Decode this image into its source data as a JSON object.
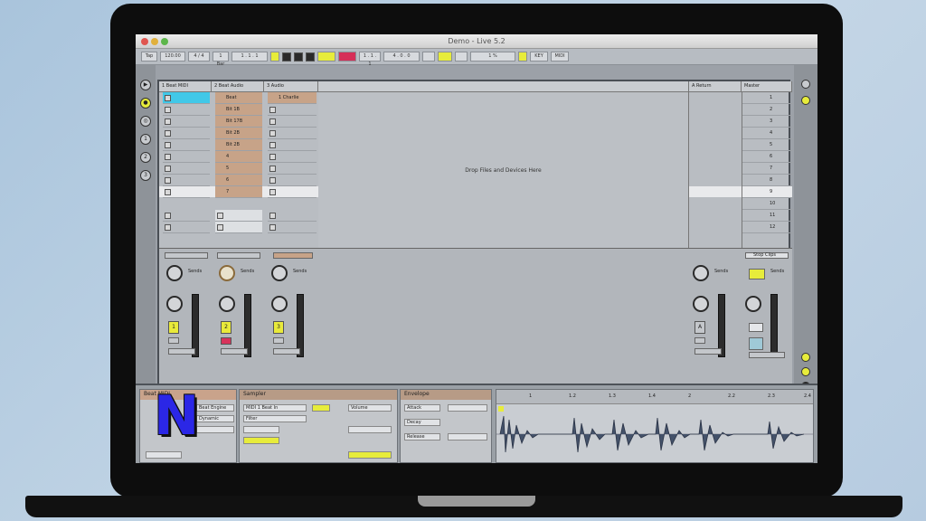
{
  "window": {
    "title": "Demo - Live 5.2"
  },
  "controlbar": {
    "tap": "Tap",
    "tempo": "120.00",
    "meter": "4 / 4",
    "quantize": "1 Bar",
    "position": "1 . 1 . 1",
    "loop_start": "1 . 1 . 1",
    "loop_length": "4 . 0 . 0",
    "key_label": "KEY",
    "midi_label": "MIDI",
    "cpu": "1 %"
  },
  "tracks": [
    {
      "name": "1 Beat MIDI",
      "clips": [
        {
          "label": "",
          "color": "cyan"
        },
        {
          "label": ""
        },
        {
          "label": ""
        },
        {
          "label": ""
        },
        {
          "label": ""
        },
        {
          "label": ""
        },
        {
          "label": ""
        },
        {
          "label": ""
        },
        {
          "label": ""
        },
        {
          "label": ""
        },
        {
          "label": ""
        },
        {
          "label": ""
        }
      ]
    },
    {
      "name": "2 Beat Audio",
      "clips": [
        {
          "label": "Beat",
          "color": "orange"
        },
        {
          "label": "Bit 1B",
          "color": "orange"
        },
        {
          "label": "Bit 17B",
          "color": "orange"
        },
        {
          "label": "Bit 2B",
          "color": "orange"
        },
        {
          "label": "Bit 2B",
          "color": "orange"
        },
        {
          "label": "4",
          "color": "orange"
        },
        {
          "label": "5",
          "color": "orange"
        },
        {
          "label": "6",
          "color": "orange"
        },
        {
          "label": "7",
          "color": "orange"
        },
        {
          "label": ""
        },
        {
          "label": ""
        },
        {
          "label": ""
        }
      ]
    },
    {
      "name": "3 Audio",
      "clips": [
        {
          "label": "1 Charlie",
          "color": "orange"
        },
        {
          "label": ""
        },
        {
          "label": ""
        },
        {
          "label": ""
        },
        {
          "label": ""
        },
        {
          "label": ""
        },
        {
          "label": ""
        },
        {
          "label": ""
        },
        {
          "label": ""
        },
        {
          "label": ""
        },
        {
          "label": ""
        },
        {
          "label": ""
        }
      ]
    }
  ],
  "dropzone": {
    "text": "Drop Files and Devices Here"
  },
  "returns": {
    "name": "A Return"
  },
  "master": {
    "name": "Master",
    "scenes": [
      "1",
      "2",
      "3",
      "4",
      "5",
      "6",
      "7",
      "8",
      "9",
      "10",
      "11",
      "12"
    ],
    "stop_clips": "Stop Clips"
  },
  "mixer": {
    "sends_label": "Sends",
    "solo_labels": [
      "1",
      "2",
      "3",
      "A"
    ]
  },
  "devices": {
    "panel1_title": "Beat MIDI",
    "panel1_fields": [
      "Beat Engine",
      "Dynamic"
    ],
    "sampler_title": "Sampler",
    "sampler_fields": [
      "MIDI 1 Beat In",
      "Filter",
      "Volume"
    ],
    "envelope_title": "Envelope",
    "envelope_fields": [
      "Attack",
      "Decay",
      "Release"
    ]
  },
  "waveform": {
    "markers": [
      "1",
      "1.2",
      "1.3",
      "1.4",
      "2",
      "2.2",
      "2.3",
      "2.4"
    ]
  },
  "colors": {
    "accent_yellow": "#e7ec3b",
    "record_red": "#d62f58",
    "clip_orange": "#c7a388",
    "clip_cyan": "#41c8e8",
    "logo_blue": "#2b27e6"
  },
  "logo": {
    "letter": "N"
  }
}
